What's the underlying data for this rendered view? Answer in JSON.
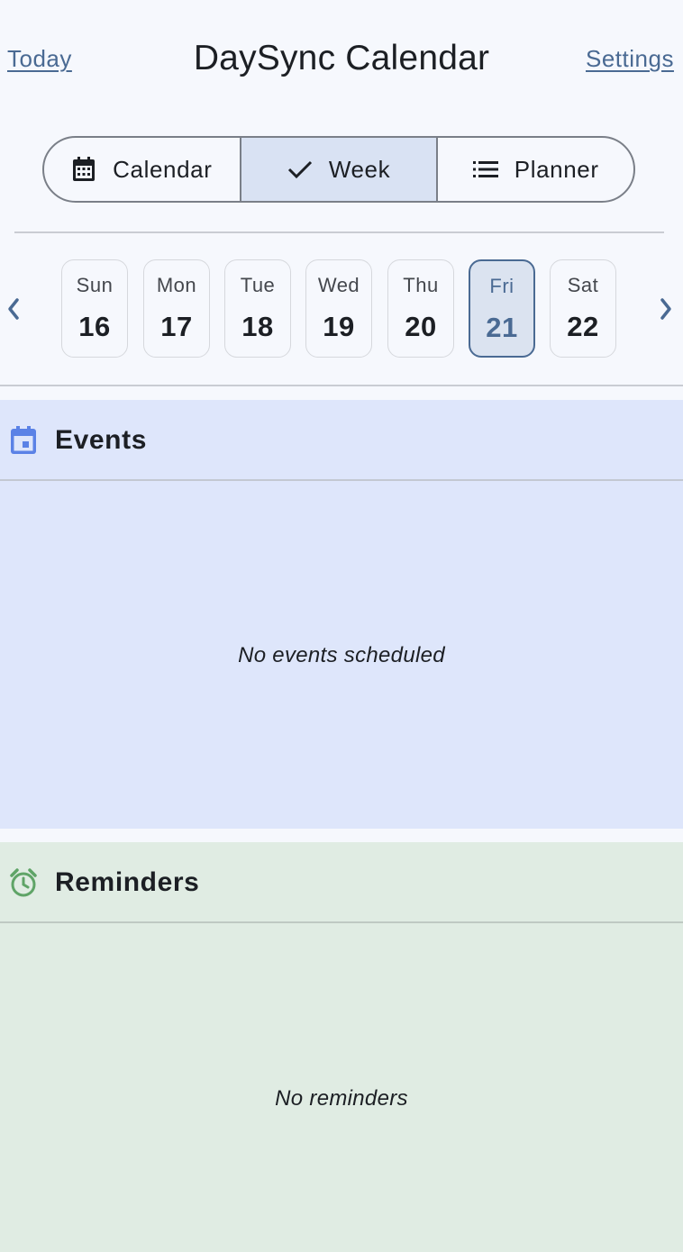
{
  "header": {
    "today_label": "Today",
    "title": "DaySync Calendar",
    "settings_label": "Settings"
  },
  "view_switcher": {
    "options": [
      {
        "label": "Calendar",
        "icon": "calendar-icon",
        "selected": false
      },
      {
        "label": "Week",
        "icon": "check-icon",
        "selected": true
      },
      {
        "label": "Planner",
        "icon": "list-icon",
        "selected": false
      }
    ]
  },
  "week": {
    "prev_icon": "chevron-left-icon",
    "next_icon": "chevron-right-icon",
    "days": [
      {
        "name": "Sun",
        "number": "16",
        "selected": false
      },
      {
        "name": "Mon",
        "number": "17",
        "selected": false
      },
      {
        "name": "Tue",
        "number": "18",
        "selected": false
      },
      {
        "name": "Wed",
        "number": "19",
        "selected": false
      },
      {
        "name": "Thu",
        "number": "20",
        "selected": false
      },
      {
        "name": "Fri",
        "number": "21",
        "selected": true
      },
      {
        "name": "Sat",
        "number": "22",
        "selected": false
      }
    ]
  },
  "events": {
    "title": "Events",
    "icon": "event-icon",
    "empty_message": "No events scheduled"
  },
  "reminders": {
    "title": "Reminders",
    "icon": "alarm-clock-icon",
    "empty_message": "No reminders"
  },
  "colors": {
    "accent": "#4a6a93",
    "events_bg": "#dee6fb",
    "reminders_bg": "#e0ece3",
    "events_icon": "#5b82e6",
    "reminders_icon": "#5fa467"
  }
}
